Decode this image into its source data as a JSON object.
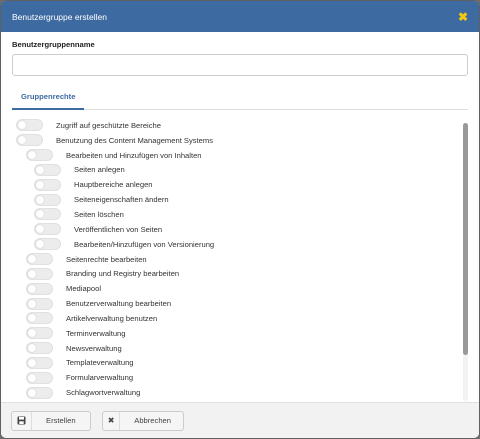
{
  "dialog": {
    "title": "Benutzergruppe erstellen",
    "close_icon": "close-x-icon",
    "accent": "#3d6aa1",
    "close_color": "#f2c811"
  },
  "form": {
    "name_label": "Benutzergruppenname",
    "name_value": "",
    "name_placeholder": ""
  },
  "tabs": [
    {
      "label": "Gruppenrechte",
      "active": true
    }
  ],
  "rights": [
    {
      "label": "Zugriff auf geschützte Bereiche",
      "level": 0,
      "enabled": false
    },
    {
      "label": "Benutzung des Content Management Systems",
      "level": 0,
      "enabled": false
    },
    {
      "label": "Bearbeiten und Hinzufügen von Inhalten",
      "level": 1,
      "enabled": false
    },
    {
      "label": "Seiten anlegen",
      "level": 2,
      "enabled": false
    },
    {
      "label": "Hauptbereiche anlegen",
      "level": 2,
      "enabled": false
    },
    {
      "label": "Seiteneigenschaften ändern",
      "level": 2,
      "enabled": false
    },
    {
      "label": "Seiten löschen",
      "level": 2,
      "enabled": false
    },
    {
      "label": "Veröffentlichen von Seiten",
      "level": 2,
      "enabled": false
    },
    {
      "label": "Bearbeiten/Hinzufügen von Versionierung",
      "level": 2,
      "enabled": false
    },
    {
      "label": "Seitenrechte bearbeiten",
      "level": 1,
      "enabled": false
    },
    {
      "label": "Branding und Registry bearbeiten",
      "level": 1,
      "enabled": false
    },
    {
      "label": "Mediapool",
      "level": 1,
      "enabled": false
    },
    {
      "label": "Benutzerverwaltung bearbeiten",
      "level": 1,
      "enabled": false
    },
    {
      "label": "Artikelverwaltung benutzen",
      "level": 1,
      "enabled": false
    },
    {
      "label": "Terminverwaltung",
      "level": 1,
      "enabled": false
    },
    {
      "label": "Newsverwaltung",
      "level": 1,
      "enabled": false
    },
    {
      "label": "Templateverwaltung",
      "level": 1,
      "enabled": false
    },
    {
      "label": "Formularverwaltung",
      "level": 1,
      "enabled": false
    },
    {
      "label": "Schlagwortverwaltung",
      "level": 1,
      "enabled": false
    }
  ],
  "footer": {
    "save_label": "Erstellen",
    "save_icon": "floppy-disk-icon",
    "cancel_label": "Abbrechen",
    "cancel_icon": "close-x-icon"
  }
}
